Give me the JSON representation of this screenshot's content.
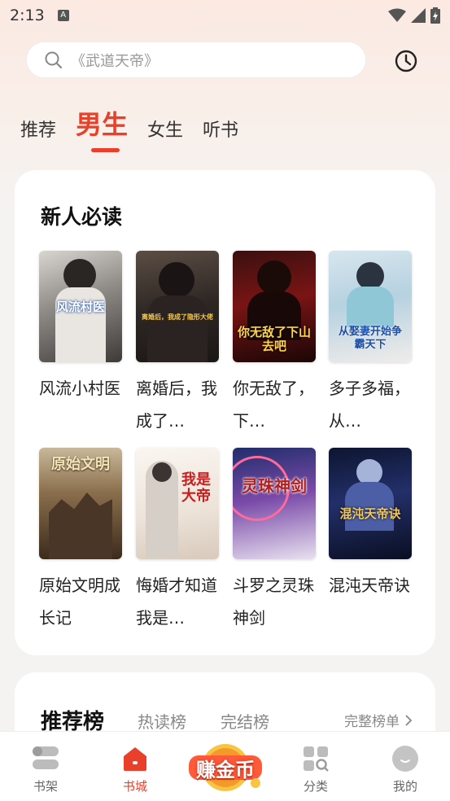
{
  "status": {
    "time": "2:13"
  },
  "search": {
    "placeholder": "《武道天帝》"
  },
  "tabs": [
    {
      "label": "推荐"
    },
    {
      "label": "男生"
    },
    {
      "label": "女生"
    },
    {
      "label": "听书"
    }
  ],
  "section_new": {
    "title": "新人必读",
    "books": [
      {
        "name": "风流小村医",
        "cover_text": "风流村医"
      },
      {
        "name": "离婚后，我成了…",
        "cover_text": "离婚后，我成了隐形大佬"
      },
      {
        "name": "你无敌了，下…",
        "cover_text": "你无敌了下山去吧"
      },
      {
        "name": "多子多福，从…",
        "cover_text": "从娶妻开始争霸天下"
      },
      {
        "name": "原始文明成长记",
        "cover_text": "原始文明"
      },
      {
        "name": "悔婚才知道我是…",
        "cover_text": "我是大帝"
      },
      {
        "name": "斗罗之灵珠神剑",
        "cover_text": "灵珠神剑"
      },
      {
        "name": "混沌天帝诀",
        "cover_text": "混沌天帝诀"
      }
    ]
  },
  "ranking": {
    "title": "推荐榜",
    "tabs": [
      "热读榜",
      "完结榜"
    ],
    "more": "完整榜单"
  },
  "bottom_nav": {
    "bookshelf": "书架",
    "bookstore": "书城",
    "earn": "赚金币",
    "category": "分类",
    "mine": "我的"
  },
  "colors": {
    "accent": "#e9402b"
  }
}
